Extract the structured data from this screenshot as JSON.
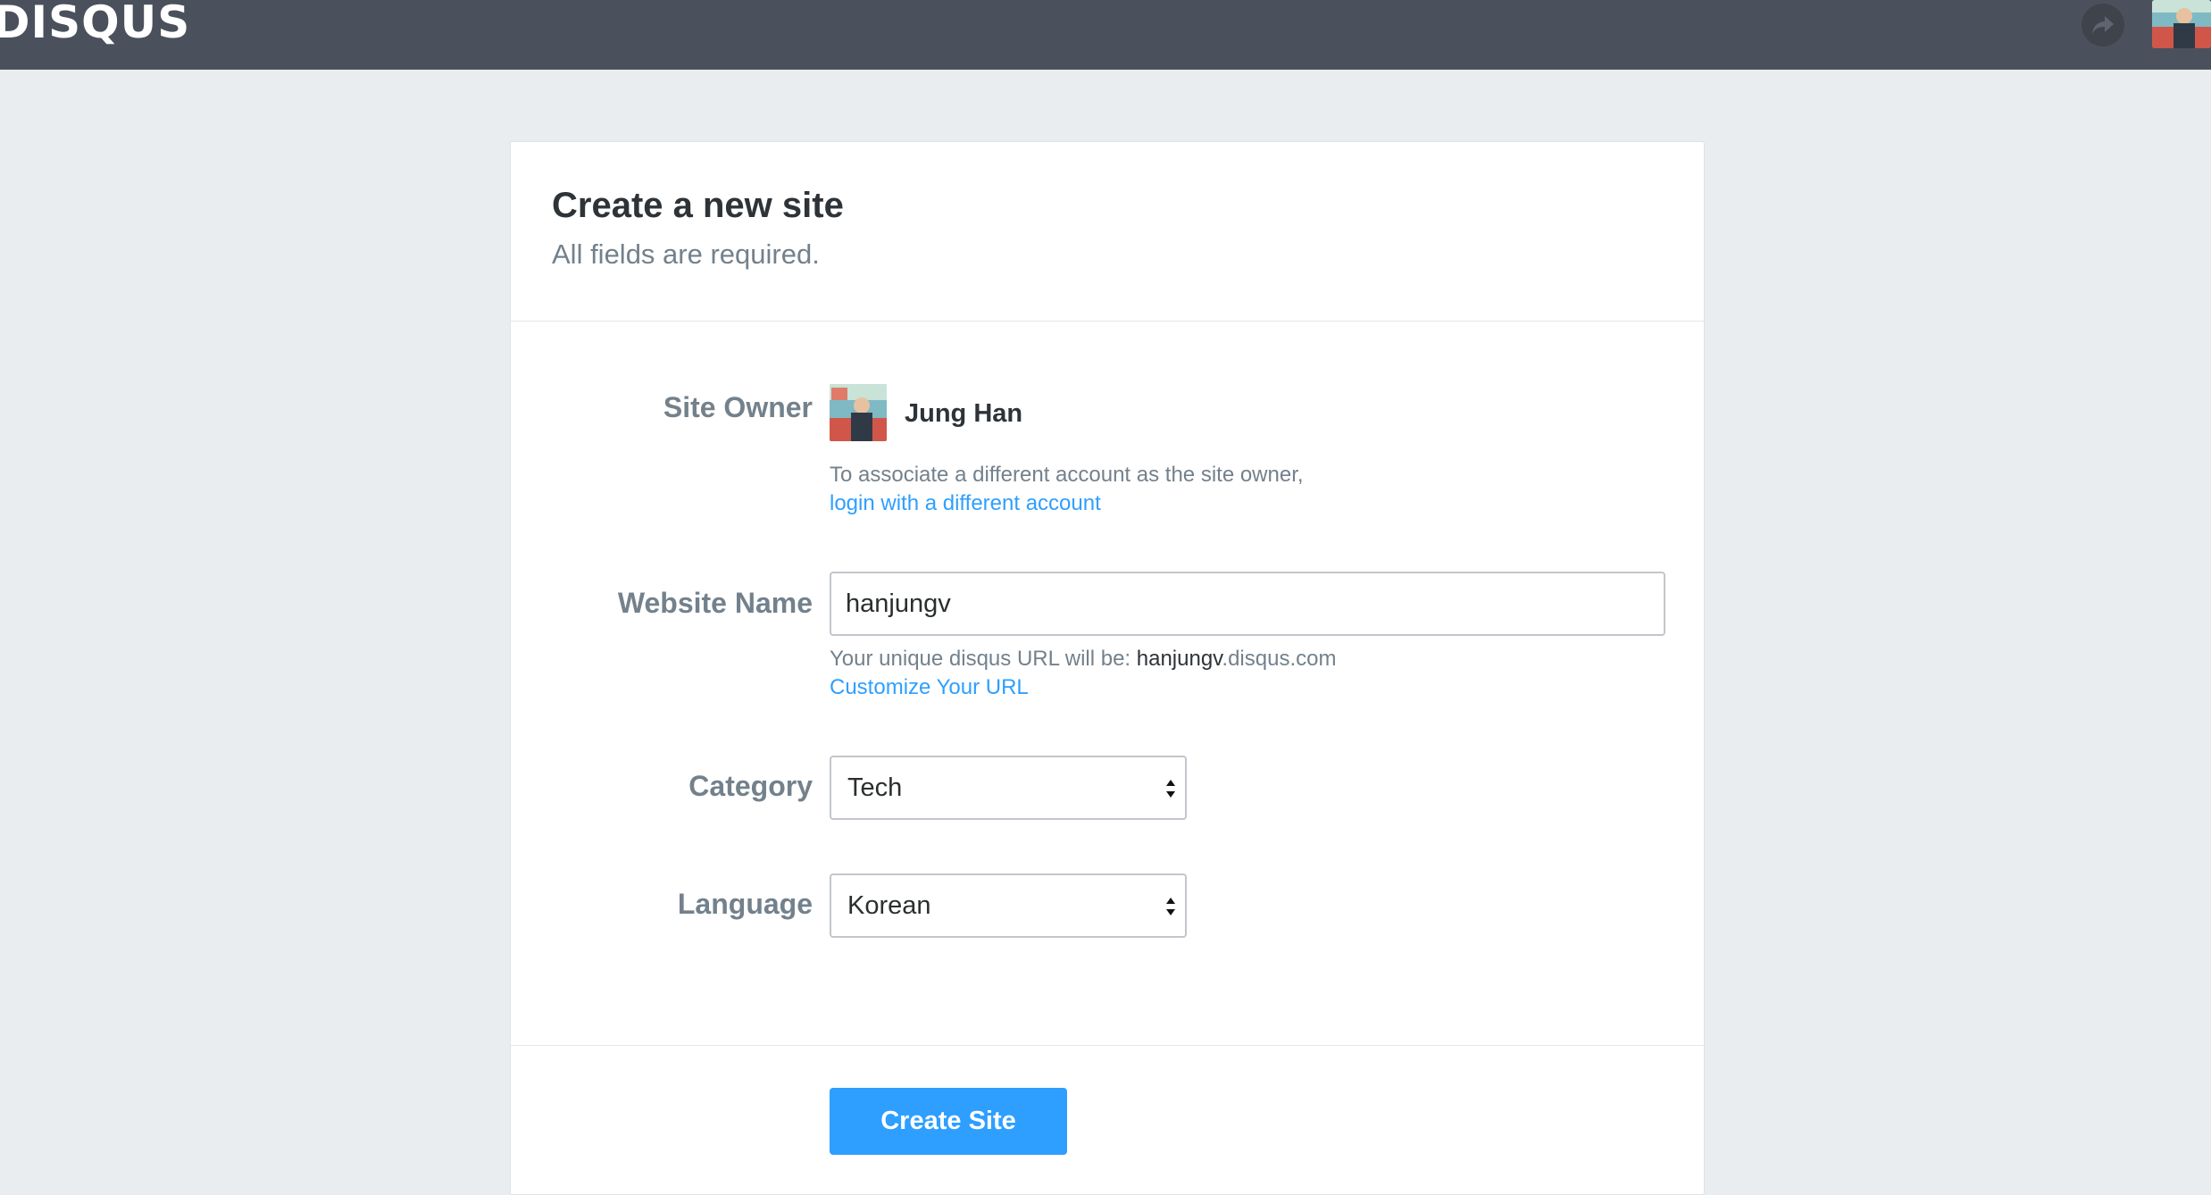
{
  "brand": {
    "logo_text": "DISQUS"
  },
  "header": {
    "notifications_icon": "share-arrow-icon",
    "avatar_icon": "user-avatar"
  },
  "form": {
    "title": "Create a new site",
    "subtitle": "All fields are required.",
    "site_owner": {
      "label": "Site Owner",
      "name": "Jung Han",
      "help_text": "To associate a different account as the site owner,",
      "link": "login with a different account"
    },
    "website_name": {
      "label": "Website Name",
      "value": "hanjungv",
      "help_prefix": "Your unique disqus URL will be: ",
      "help_slug": "hanjungv",
      "help_suffix": ".disqus.com",
      "link": "Customize Your URL"
    },
    "category": {
      "label": "Category",
      "selected": "Tech"
    },
    "language": {
      "label": "Language",
      "selected": "Korean"
    },
    "submit_label": "Create Site"
  },
  "colors": {
    "topbar": "#4b515c",
    "page_bg": "#e9edf0",
    "accent": "#2e9fff",
    "muted_text": "#73818c",
    "dark_text": "#2e3338"
  }
}
